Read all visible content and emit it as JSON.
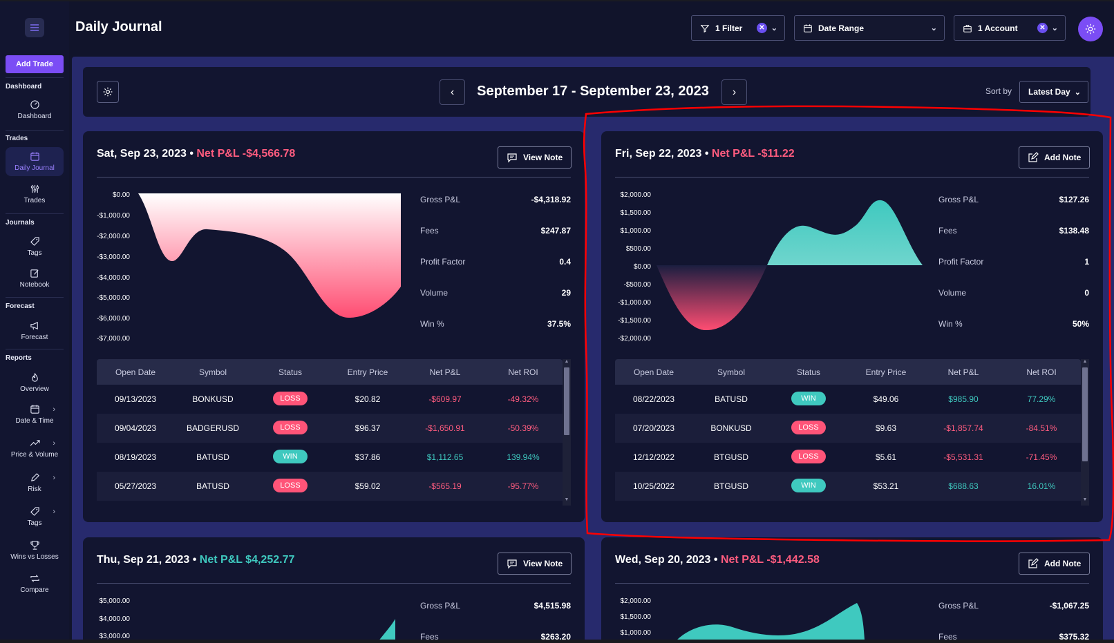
{
  "header": {
    "title": "Daily Journal",
    "filter_label": "1 Filter",
    "date_range_label": "Date Range",
    "account_label": "1 Account"
  },
  "sidebar": {
    "add_trade": "Add Trade",
    "sections": {
      "dashboard": "Dashboard",
      "trades": "Trades",
      "journals": "Journals",
      "forecast": "Forecast",
      "reports": "Reports"
    },
    "items": {
      "dashboard": "Dashboard",
      "daily_journal": "Daily Journal",
      "trades": "Trades",
      "tags": "Tags",
      "notebook": "Notebook",
      "forecast": "Forecast",
      "overview": "Overview",
      "date_time": "Date & Time",
      "price_volume": "Price & Volume",
      "risk": "Risk",
      "report_tags": "Tags",
      "wins_losses": "Wins vs Losses",
      "compare": "Compare"
    }
  },
  "week": {
    "title": "September 17 - September 23, 2023",
    "sort_label": "Sort by",
    "sort_value": "Latest Day"
  },
  "table_headers": [
    "Open Date",
    "Symbol",
    "Status",
    "Entry Price",
    "Net P&L",
    "Net ROI"
  ],
  "stat_labels": [
    "Gross P&L",
    "Fees",
    "Profit Factor",
    "Volume",
    "Win %"
  ],
  "colors": {
    "accent": "#7b4df5",
    "loss": "#ff5478",
    "win": "#3fc9bf",
    "annotation": "#ff0000"
  },
  "days": [
    {
      "date": "Sat, Sep 23, 2023",
      "sep": "•",
      "pnl_label": "Net P&L -$4,566.78",
      "pnl_sign": "neg",
      "note_button": "View Note",
      "y_ticks": [
        "$0.00",
        "-$1,000.00",
        "-$2,000.00",
        "-$3,000.00",
        "-$4,000.00",
        "-$5,000.00",
        "-$6,000.00",
        "-$7,000.00"
      ],
      "stats": [
        "-$4,318.92",
        "$247.87",
        "0.4",
        "29",
        "37.5%"
      ],
      "rows": [
        [
          "09/13/2023",
          "BONKUSD",
          "LOSS",
          "$20.82",
          "-$609.97",
          "-49.32%"
        ],
        [
          "09/04/2023",
          "BADGERUSD",
          "LOSS",
          "$96.37",
          "-$1,650.91",
          "-50.39%"
        ],
        [
          "08/19/2023",
          "BATUSD",
          "WIN",
          "$37.86",
          "$1,112.65",
          "139.94%"
        ],
        [
          "05/27/2023",
          "BATUSD",
          "LOSS",
          "$59.02",
          "-$565.19",
          "-95.77%"
        ]
      ]
    },
    {
      "date": "Fri, Sep 22, 2023",
      "sep": "•",
      "pnl_label": "Net P&L -$11.22",
      "pnl_sign": "neg",
      "note_button": "Add Note",
      "y_ticks": [
        "$2,000.00",
        "$1,500.00",
        "$1,000.00",
        "$500.00",
        "$0.00",
        "-$500.00",
        "-$1,000.00",
        "-$1,500.00",
        "-$2,000.00"
      ],
      "stats": [
        "$127.26",
        "$138.48",
        "1",
        "0",
        "50%"
      ],
      "rows": [
        [
          "08/22/2023",
          "BATUSD",
          "WIN",
          "$49.06",
          "$985.90",
          "77.29%"
        ],
        [
          "07/20/2023",
          "BONKUSD",
          "LOSS",
          "$9.63",
          "-$1,857.74",
          "-84.51%"
        ],
        [
          "12/12/2022",
          "BTGUSD",
          "LOSS",
          "$5.61",
          "-$5,531.31",
          "-71.45%"
        ],
        [
          "10/25/2022",
          "BTGUSD",
          "WIN",
          "$53.21",
          "$688.63",
          "16.01%"
        ]
      ]
    },
    {
      "date": "Thu, Sep 21, 2023",
      "sep": "•",
      "pnl_label": "Net P&L $4,252.77",
      "pnl_sign": "pos",
      "note_button": "View Note",
      "y_ticks": [
        "$5,000.00",
        "$4,000.00",
        "$3,000.00"
      ],
      "stats": [
        "$4,515.98",
        "$263.20"
      ]
    },
    {
      "date": "Wed, Sep 20, 2023",
      "sep": "•",
      "pnl_label": "Net P&L -$1,442.58",
      "pnl_sign": "neg",
      "note_button": "Add Note",
      "y_ticks": [
        "$2,000.00",
        "$1,500.00",
        "$1,000.00"
      ],
      "stats": [
        "-$1,067.25",
        "$375.32"
      ]
    }
  ]
}
